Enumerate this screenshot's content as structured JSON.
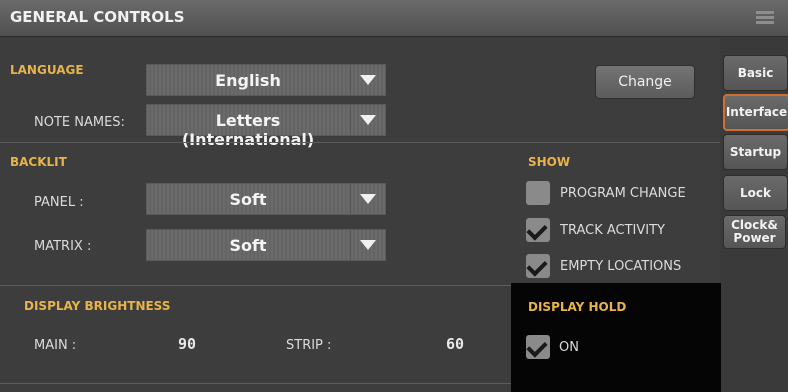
{
  "header": {
    "title": "GENERAL CONTROLS",
    "menu_icon": "hamburger-menu-icon"
  },
  "language": {
    "section": "LANGUAGE",
    "value": "English",
    "change_label": "Change"
  },
  "note_names": {
    "label": "NOTE NAMES:",
    "value": "Letters (International)"
  },
  "backlit": {
    "section": "BACKLIT",
    "panel": {
      "label": "PANEL :",
      "value": "Soft"
    },
    "matrix": {
      "label": "MATRIX :",
      "value": "Soft"
    }
  },
  "show": {
    "section": "SHOW",
    "items": [
      {
        "label": "PROGRAM CHANGE",
        "checked": false
      },
      {
        "label": "TRACK ACTIVITY",
        "checked": true
      },
      {
        "label": "EMPTY LOCATIONS",
        "checked": true
      }
    ]
  },
  "brightness": {
    "section": "DISPLAY BRIGHTNESS",
    "main_label": "MAIN :",
    "main_value": "90",
    "strip_label": "STRIP :",
    "strip_value": "60"
  },
  "hold": {
    "section": "DISPLAY HOLD",
    "label": "ON",
    "checked": true
  },
  "tabs": [
    {
      "label": "Basic"
    },
    {
      "label": "Interface"
    },
    {
      "label": "Startup"
    },
    {
      "label": "Lock"
    },
    {
      "label": "Clock& Power"
    }
  ],
  "colors": {
    "accent": "#e8b34a",
    "active_tab_border": "#d07030"
  }
}
